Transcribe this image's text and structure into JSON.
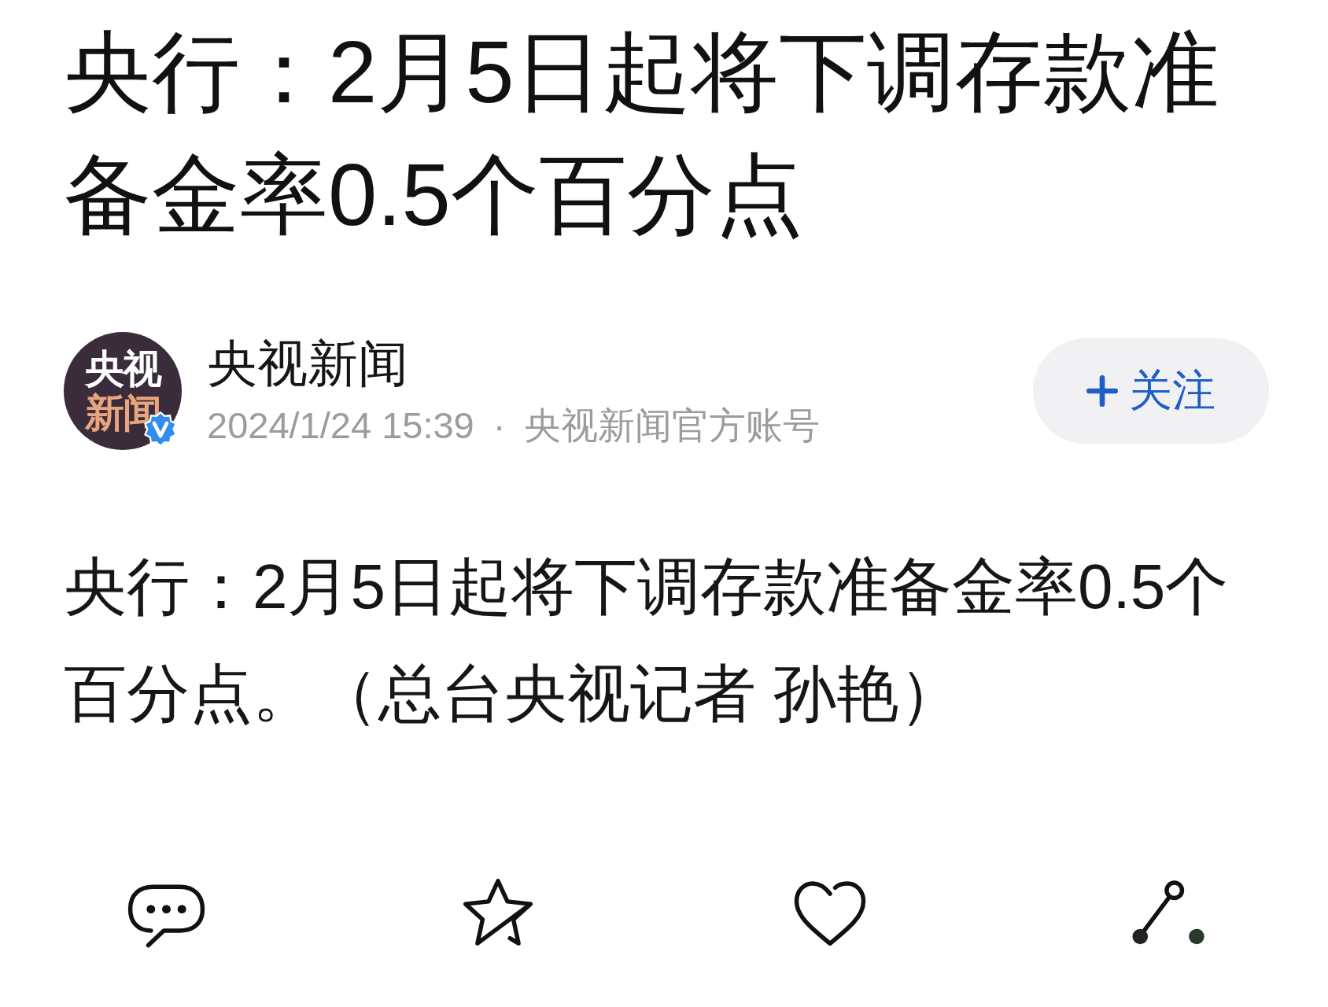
{
  "article": {
    "title": "央行：2月5日起将下调存款准备金率0.5个百分点",
    "author": {
      "avatar": {
        "line_1": "央视",
        "line_2": "新闻",
        "verified": true
      },
      "name": "央视新闻",
      "timestamp": "2024/1/24 15:39",
      "separator": "·",
      "account_type": "央视新闻官方账号"
    },
    "follow_button": {
      "label": "关注"
    },
    "body": "央行：2月5日起将下调存款准备金率0.5个百分点。（总台央视记者 孙艳）"
  },
  "action_bar": [
    {
      "kind": "comment"
    },
    {
      "kind": "favorite"
    },
    {
      "kind": "like"
    },
    {
      "kind": "share"
    }
  ]
}
